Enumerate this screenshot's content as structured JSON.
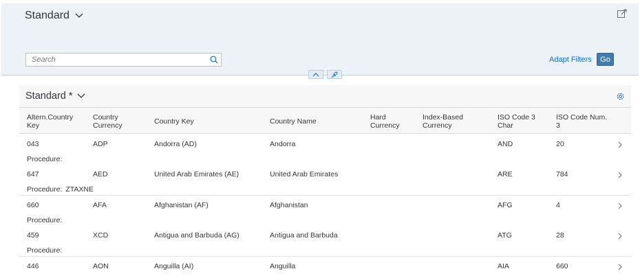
{
  "header": {
    "variant_title": "Standard",
    "share_icon": "share-icon",
    "chevron_icon": "chevron-down-icon"
  },
  "filterbar": {
    "search_placeholder": "Search",
    "search_value": "",
    "adapt_filters_label": "Adapt Filters",
    "go_label": "Go"
  },
  "table": {
    "title": "Standard *",
    "columns": [
      [
        "Altern.Country",
        "Key"
      ],
      [
        "Country",
        "Currency"
      ],
      [
        "Country Key"
      ],
      [
        "Country Name"
      ],
      [
        "Hard",
        "Currency"
      ],
      [
        "Index-Based",
        "Currency"
      ],
      [
        "ISO Code 3",
        "Char"
      ],
      [
        "ISO Code Num.",
        "3"
      ]
    ],
    "procedure_label": "Procedure:",
    "rows": [
      {
        "alt_key": "043",
        "currency": "ADP",
        "country_key": "Andorra (AD)",
        "country_name": "Andorra",
        "hard_currency": "",
        "index_currency": "",
        "iso3": "AND",
        "iso_num": "20",
        "procedure": ""
      },
      {
        "alt_key": "647",
        "currency": "AED",
        "country_key": "United Arab Emirates (AE)",
        "country_name": "United Arab Emirates",
        "hard_currency": "",
        "index_currency": "",
        "iso3": "ARE",
        "iso_num": "784",
        "procedure": "ZTAXNE"
      },
      {
        "alt_key": "660",
        "currency": "AFA",
        "country_key": "Afghanistan (AF)",
        "country_name": "Afghanistan",
        "hard_currency": "",
        "index_currency": "",
        "iso3": "AFG",
        "iso_num": "4",
        "procedure": ""
      },
      {
        "alt_key": "459",
        "currency": "XCD",
        "country_key": "Antigua and Barbuda (AG)",
        "country_name": "Antigua and Barbuda",
        "hard_currency": "",
        "index_currency": "",
        "iso3": "ATG",
        "iso_num": "28",
        "procedure": ""
      },
      {
        "alt_key": "446",
        "currency": "AON",
        "country_key": "Anguilla (AI)",
        "country_name": "Anguilla",
        "hard_currency": "",
        "index_currency": "",
        "iso3": "AIA",
        "iso_num": "660",
        "procedure": ""
      }
    ]
  },
  "colors": {
    "accent": "#0a6ed1",
    "go_button": "#427cac",
    "header_bg": "#edf2f7"
  }
}
